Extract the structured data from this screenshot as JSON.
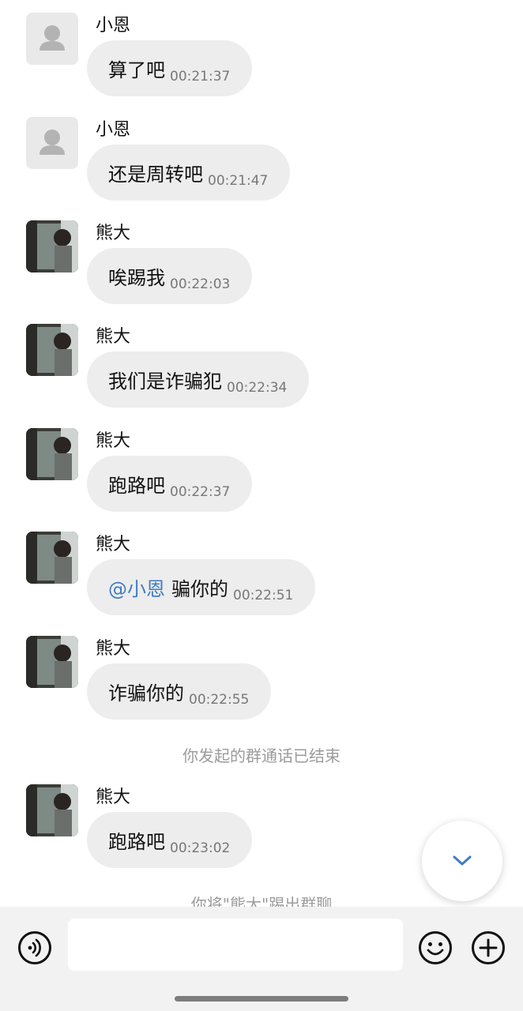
{
  "messages": [
    {
      "sender": "小恩",
      "avatar": "default-person-icon",
      "text": "算了吧",
      "time": "00:21:37"
    },
    {
      "sender": "小恩",
      "avatar": "default-person-icon",
      "text": "还是周转吧",
      "time": "00:21:47"
    },
    {
      "sender": "熊大",
      "avatar": "photo-avatar",
      "text": "唉踢我",
      "time": "00:22:03"
    },
    {
      "sender": "熊大",
      "avatar": "photo-avatar",
      "text": "我们是诈骗犯",
      "time": "00:22:34"
    },
    {
      "sender": "熊大",
      "avatar": "photo-avatar",
      "text": "跑路吧",
      "time": "00:22:37"
    },
    {
      "sender": "熊大",
      "avatar": "photo-avatar",
      "mention": "@小恩",
      "text": "骗你的",
      "time": "00:22:51"
    },
    {
      "sender": "熊大",
      "avatar": "photo-avatar",
      "text": "诈骗你的",
      "time": "00:22:55"
    }
  ],
  "system_notice_1": "你发起的群通话已结束",
  "last_message": {
    "sender": "熊大",
    "avatar": "photo-avatar",
    "text": "跑路吧",
    "time": "00:23:02"
  },
  "system_notice_2": "你将\"熊大\"踢出群聊",
  "bottom_bar": {
    "voice_icon": "voice-icon",
    "emoji_icon": "emoji-icon",
    "plus_icon": "plus-icon",
    "input_value": ""
  },
  "scroll_icon": "chevron-down-icon",
  "colors": {
    "bubble": "#ededed",
    "mention": "#3e7cc4",
    "system_text": "#9b9b9b"
  }
}
